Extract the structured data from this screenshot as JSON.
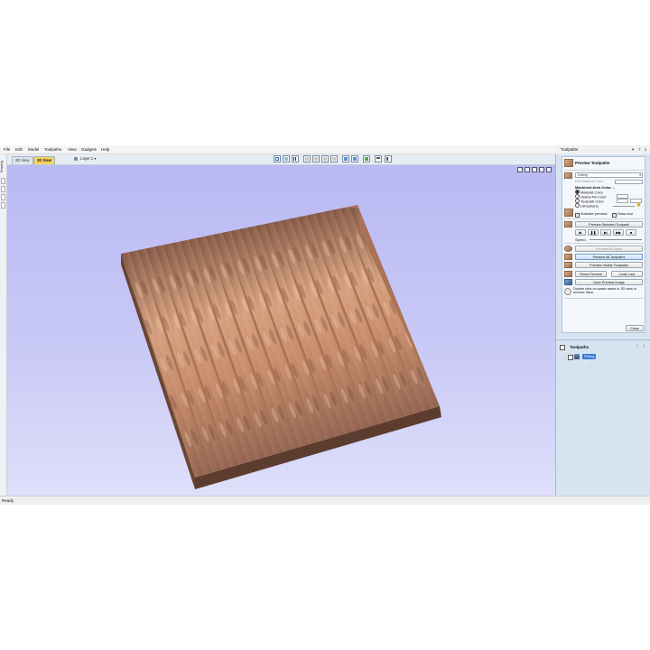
{
  "menu": [
    "File",
    "Edit",
    "Model",
    "Toolpaths",
    "View",
    "Gadgets",
    "Help"
  ],
  "tabs": {
    "view2d": "2D View",
    "view3d": "3D View"
  },
  "layer": {
    "label": "Layer 1"
  },
  "left_strip": {
    "label": "Drawing"
  },
  "status": {
    "text": "Ready"
  },
  "right_panel": {
    "title": "Toolpaths",
    "pin": "▾",
    "help": "?",
    "close": "x",
    "preview": {
      "heading": "Preview Toolpaths",
      "material": "Cherry",
      "material_btn": "Edit Material Color",
      "machined_heading": "Machined Area Color ...",
      "options": [
        "Material Color",
        "Global Fill Color",
        "Toolpath Color",
        "Lithophane"
      ],
      "animate": "Animate preview",
      "draw_tool": "Draw tool",
      "preview_selected": "Preview Selected Toolpath",
      "speed": "Speed",
      "preview_all_slabs": "Preview All Slabs",
      "preview_all": "Preview All Toolpaths",
      "preview_visible": "Preview Visible Toolpaths",
      "reset": "Reset Preview",
      "undo": "Undo Last",
      "save_image": "Save Preview Image",
      "hint": "Double click on waste areas in 3D view to remove them.",
      "close_btn": "Close"
    },
    "toolpaths": {
      "heading": "Toolpaths",
      "item": "Fluting 1"
    }
  },
  "colors": {
    "viewport_top": "#b9b9f4",
    "viewport_bottom": "#dedffa",
    "wood_light": "#c98e6c",
    "wood_dark": "#6e4a38",
    "panel_bg": "#d6e4f2",
    "accent_yellow": "#f4d35e"
  }
}
